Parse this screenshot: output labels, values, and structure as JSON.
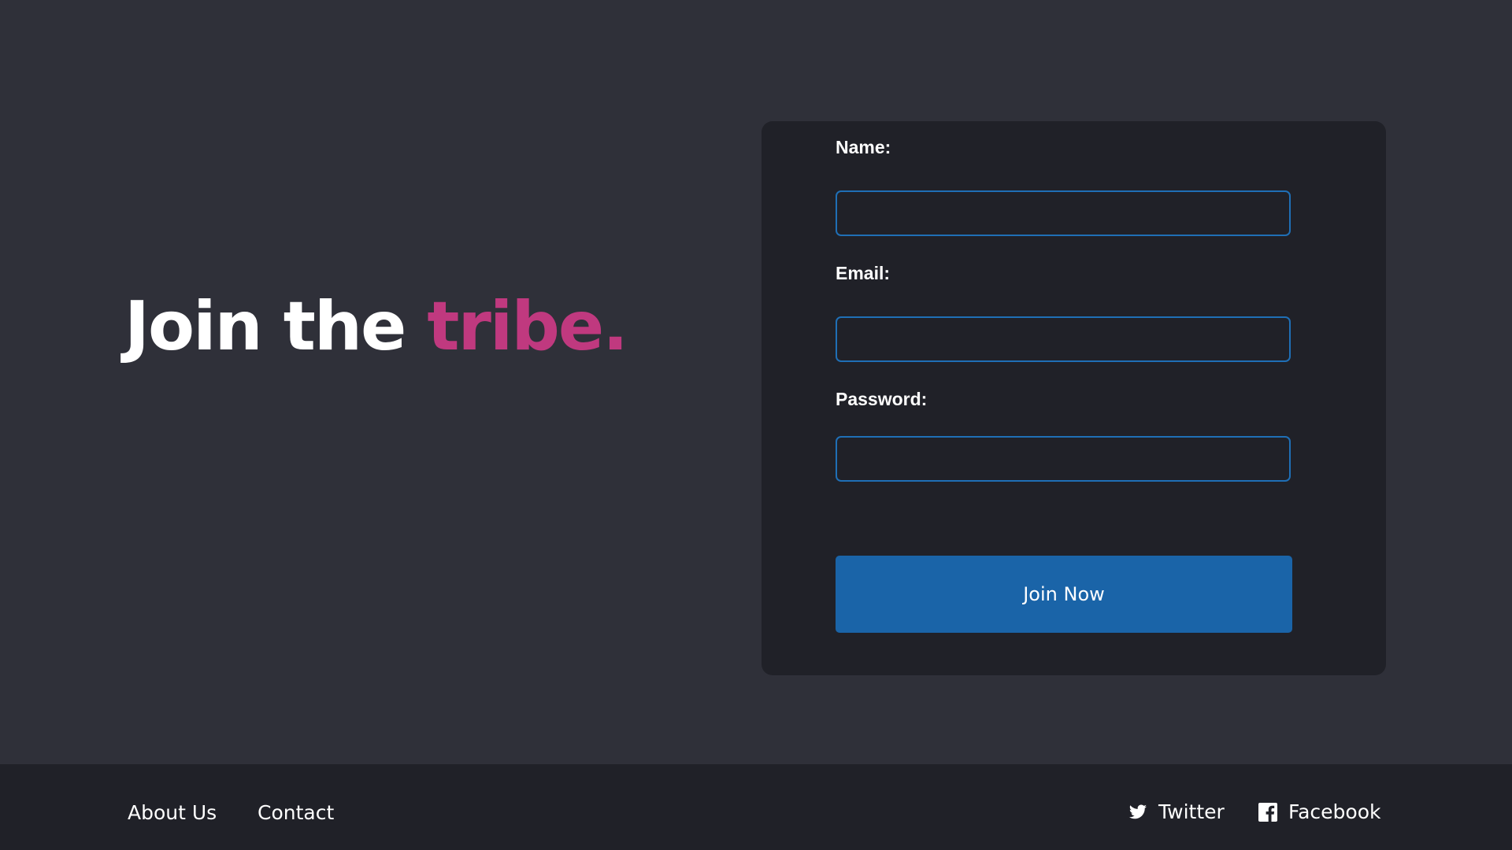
{
  "hero": {
    "title_main": "Join the ",
    "title_accent": "tribe."
  },
  "form": {
    "name_label": "Name:",
    "name_value": "",
    "email_label": "Email:",
    "email_value": "",
    "password_label": "Password:",
    "password_value": "",
    "submit_label": "Join Now"
  },
  "footer": {
    "links": [
      {
        "label": "About Us"
      },
      {
        "label": "Contact"
      }
    ],
    "social": [
      {
        "label": "Twitter",
        "icon": "twitter-icon"
      },
      {
        "label": "Facebook",
        "icon": "facebook-icon"
      }
    ]
  },
  "colors": {
    "background": "#2f3039",
    "card": "#202128",
    "accent": "#c0397f",
    "primary": "#1a64a8",
    "input_border": "#1f6fb6"
  }
}
